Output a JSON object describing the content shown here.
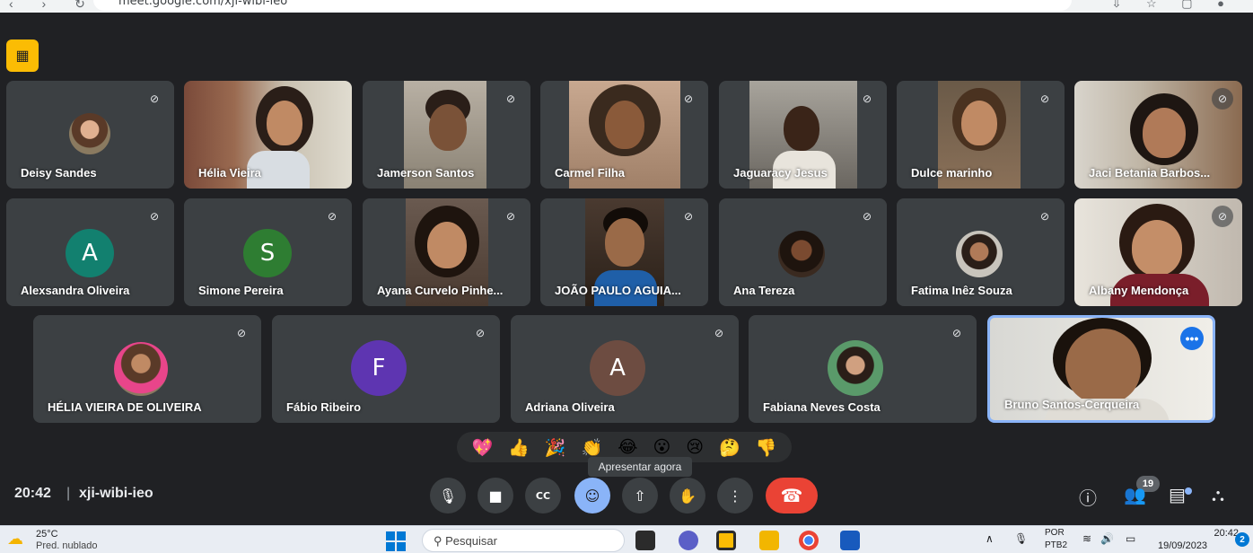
{
  "browser": {
    "url": "meet.google.com/xji-wibi-ieo"
  },
  "participants_row1": [
    {
      "name": "Deisy Sandes"
    },
    {
      "name": "Hélia Vieira"
    },
    {
      "name": "Jamerson Santos"
    },
    {
      "name": "Carmel Filha"
    },
    {
      "name": "Jaguaracy Jesus"
    },
    {
      "name": "Dulce marinho"
    },
    {
      "name": "Jaci Betania Barbos..."
    }
  ],
  "participants_row2": [
    {
      "name": "Alexsandra Oliveira",
      "initial": "A",
      "color": "#12806f"
    },
    {
      "name": "Simone Pereira",
      "initial": "S",
      "color": "#2e7d32"
    },
    {
      "name": "Ayana Curvelo Pinhe..."
    },
    {
      "name": "JOÃO PAULO AGUIA..."
    },
    {
      "name": "Ana Tereza"
    },
    {
      "name": "Fatima Inêz Souza"
    },
    {
      "name": "Albany Mendonça"
    }
  ],
  "participants_row3": [
    {
      "name": "HÉLIA VIEIRA DE OLIVEIRA"
    },
    {
      "name": "Fábio Ribeiro",
      "initial": "F",
      "color": "#5e35b1"
    },
    {
      "name": "Adriana Oliveira",
      "initial": "A",
      "color": "#6d4c41"
    },
    {
      "name": "Fabiana Neves Costa"
    },
    {
      "name": "Bruno Santos-Cerqueira"
    }
  ],
  "reactions": [
    "💖",
    "👍",
    "🎉",
    "👏",
    "😂",
    "😮",
    "😢",
    "🤔",
    "👎"
  ],
  "tooltip": "Apresentar agora",
  "meeting": {
    "time": "20:42",
    "separator": "|",
    "code": "xji-wibi-ieo"
  },
  "people_count": "19",
  "taskbar": {
    "temp": "25°C",
    "condition": "Pred. nublado",
    "search_placeholder": "Pesquisar",
    "lang_top": "POR",
    "lang_bottom": "PTB2",
    "time": "20:42",
    "date": "19/09/2023",
    "notifications": "2"
  },
  "colors": {
    "accent": "#8ab4f8",
    "end_call": "#ea4335",
    "badge": "#fbbc04"
  }
}
